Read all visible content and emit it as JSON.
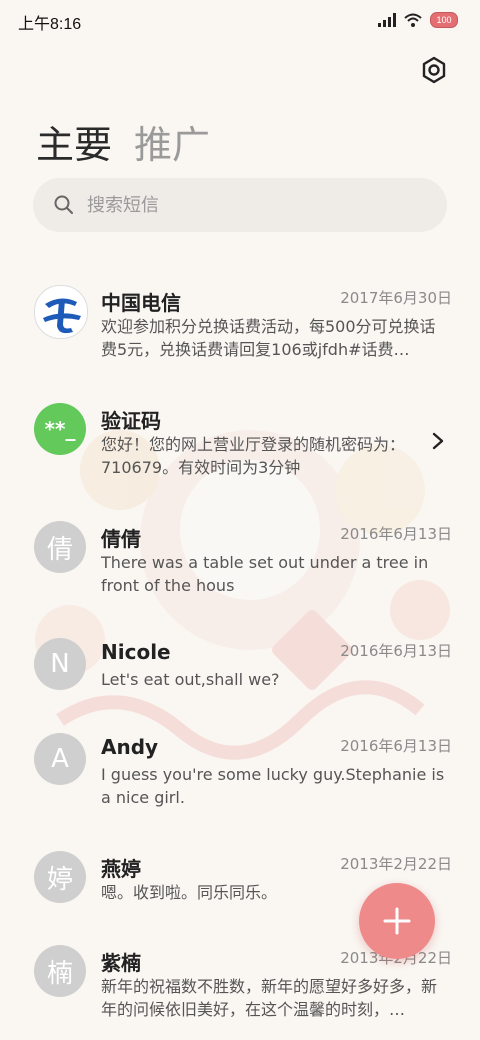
{
  "status": {
    "time": "上午8:16",
    "battery": "100"
  },
  "tabs": [
    {
      "label": "主要",
      "active": true
    },
    {
      "label": "推广",
      "active": false
    }
  ],
  "search": {
    "placeholder": "搜索短信"
  },
  "messages": [
    {
      "name": "中国电信",
      "date": "2017年6月30日",
      "preview": "欢迎参加积分兑换话费活动，每500分可兑换话费5元，兑换话费请回复106或jfdh#话费…",
      "avatar": "china-telecom-logo"
    },
    {
      "name": "验证码",
      "date": "",
      "preview": "您好！您的网上营业厅登录的随机密码为：710679。有效时间为3分钟",
      "avatar_text": "**_"
    },
    {
      "name": "倩倩",
      "date": "2016年6月13日",
      "preview": "There was a table set out under a tree in front of the hous",
      "avatar_text": "倩"
    },
    {
      "name": "Nicole",
      "date": "2016年6月13日",
      "preview": "Let's eat out,shall we?",
      "avatar_text": "N"
    },
    {
      "name": "Andy",
      "date": "2016年6月13日",
      "preview": "I guess you're some lucky guy.Stephanie is a nice girl.",
      "avatar_text": "A"
    },
    {
      "name": "燕婷",
      "date": "2013年2月22日",
      "preview": "嗯。收到啦。同乐同乐。",
      "avatar_text": "婷"
    },
    {
      "name": "紫楠",
      "date": "2013年2月22日",
      "preview": "新年的祝福数不胜数，新年的愿望好多好多，新年的问候依旧美好，在这个温馨的时刻，…",
      "avatar_text": "楠"
    }
  ],
  "colors": {
    "accent": "#ef8a8b",
    "verify_avatar": "#62c95a",
    "contact_avatar": "#cfcfcf",
    "telecom_blue": "#1e5bb8"
  }
}
